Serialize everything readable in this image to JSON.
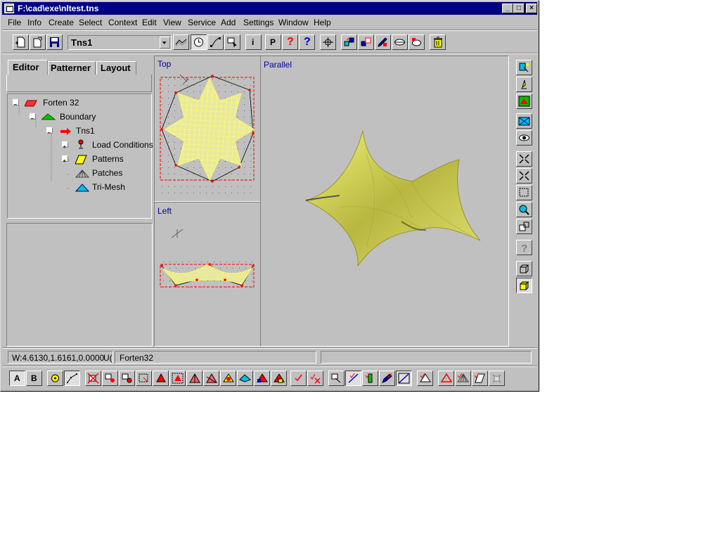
{
  "window": {
    "title": "F:\\cad\\exe\\nltest.tns",
    "controls": [
      "_",
      "□",
      "×"
    ]
  },
  "menu": [
    "File",
    "Info",
    "Create",
    "Select",
    "Context",
    "Edit",
    "View",
    "Service",
    "Add",
    "Settings",
    "Window",
    "Help"
  ],
  "toolbar": {
    "combo_value": "Tns1",
    "info_label": "i",
    "p_label": "P",
    "help_label": "?",
    "help2_label": "?"
  },
  "tabs": [
    "Editor",
    "Patterner",
    "Layout"
  ],
  "tree": [
    {
      "label": "Forten 32",
      "icon": "plane-icon",
      "color": "#ff0000"
    },
    {
      "label": "Boundary",
      "icon": "boundary-icon",
      "color": "#00c000"
    },
    {
      "label": "Tns1",
      "icon": "arrow-icon",
      "color": "#ff0000"
    },
    {
      "label": "Load Conditions",
      "icon": "load-icon"
    },
    {
      "label": "Patterns",
      "icon": "patterns-icon",
      "color": "#ffff00"
    },
    {
      "label": "Patches",
      "icon": "patches-icon"
    },
    {
      "label": "Tri-Mesh",
      "icon": "trimesh-icon",
      "color": "#00c0c0"
    }
  ],
  "viewports": {
    "top": "Top",
    "left": "Left",
    "parallel": "Parallel"
  },
  "status": {
    "coords": "W:4.6130,1.6161,0.0000",
    "units": "U(",
    "name": "Forten32",
    "message": ""
  },
  "bottom_toolbar": {
    "a_label": "A",
    "b_label": "B"
  },
  "colors": {
    "mesh": "#ffff66",
    "surface": "#d8d860",
    "titlebar": "#000080",
    "face": "#c0c0c0"
  }
}
